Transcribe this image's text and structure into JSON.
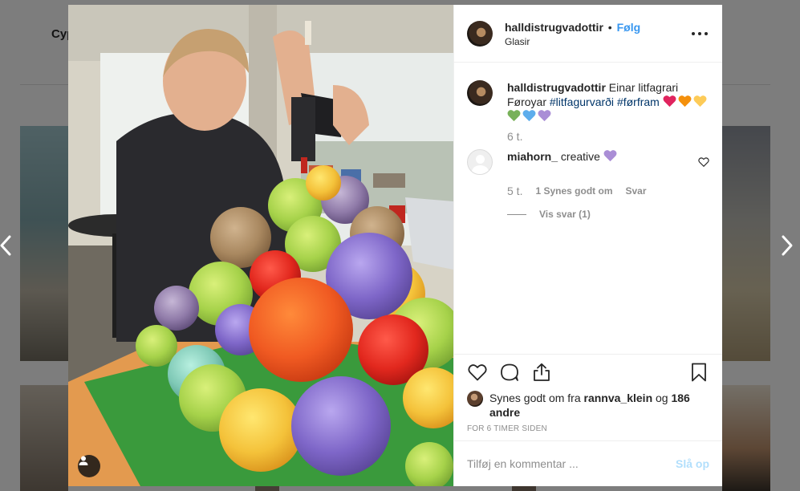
{
  "background": {
    "profile_name_partial": "Cyp"
  },
  "post": {
    "username": "halldistrugvadottir",
    "separator": "•",
    "follow_label": "Følg",
    "location": "Glasir",
    "more_icon": "more-horizontal-icon"
  },
  "caption": {
    "username": "halldistrugvadottir",
    "text": "Einar litfagrari Føroyar",
    "hashtags": [
      "#litfagurvarði",
      "#førfram"
    ],
    "hearts": [
      "#e0245e",
      "#f4900c",
      "#fdcb58",
      "#78b159",
      "#5dadec",
      "#aa8ed6"
    ],
    "time": "6 t."
  },
  "comment": {
    "username": "miahorn_",
    "text": "creative",
    "heart_color": "#aa8ed6",
    "time": "5 t.",
    "likes": "1 Synes godt om",
    "reply_label": "Svar",
    "view_replies": "Vis svar (1)"
  },
  "actions": {
    "like_icon": "heart-icon",
    "comment_icon": "comment-icon",
    "share_icon": "share-icon",
    "save_icon": "bookmark-icon"
  },
  "likes": {
    "prefix": "Synes godt om fra",
    "user": "rannva_klein",
    "conj": "og",
    "others": "186 andre"
  },
  "timestamp": "FOR 6 TIMER SIDEN",
  "add_comment": {
    "placeholder": "Tilføj en kommentar ...",
    "post_label": "Slå op"
  },
  "colors": {
    "link_blue": "#3897f0",
    "hashtag_blue": "#003569",
    "muted": "#8e8e8e",
    "post_disabled": "#b2dffc"
  }
}
